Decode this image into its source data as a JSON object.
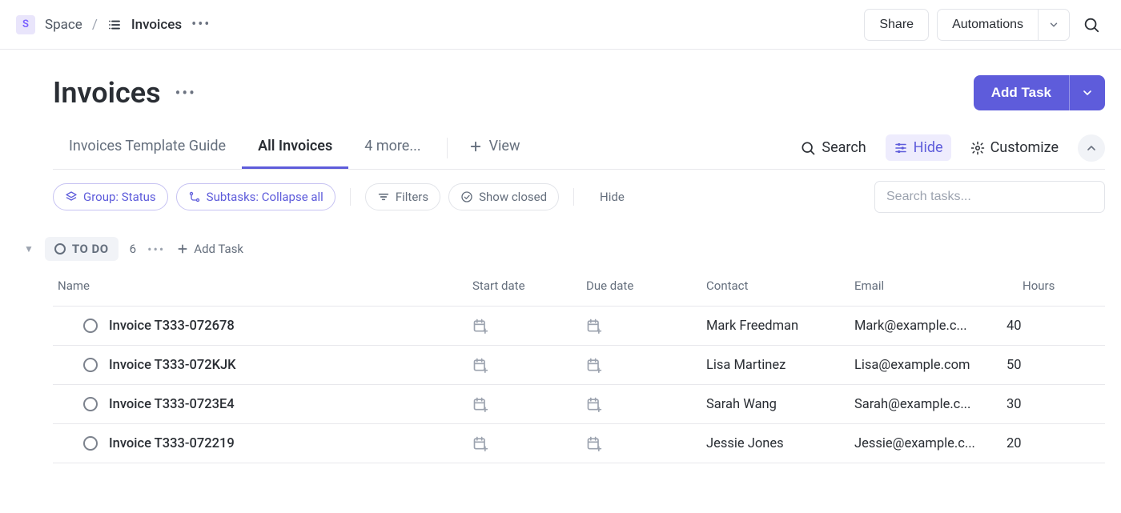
{
  "breadcrumb": {
    "space_letter": "S",
    "space_label": "Space",
    "current": "Invoices"
  },
  "topbar": {
    "share": "Share",
    "automations": "Automations"
  },
  "page": {
    "title": "Invoices",
    "add_task": "Add Task"
  },
  "tabs": {
    "guide": "Invoices Template Guide",
    "all": "All Invoices",
    "more": "4 more...",
    "add_view": "View"
  },
  "tab_actions": {
    "search": "Search",
    "hide": "Hide",
    "customize": "Customize"
  },
  "filters": {
    "group": "Group: Status",
    "subtasks": "Subtasks: Collapse all",
    "filters": "Filters",
    "show_closed": "Show closed",
    "hide": "Hide",
    "search_placeholder": "Search tasks..."
  },
  "group": {
    "status": "TO DO",
    "count": "6",
    "add": "Add Task"
  },
  "columns": {
    "name": "Name",
    "start": "Start date",
    "due": "Due date",
    "contact": "Contact",
    "email": "Email",
    "hours": "Hours"
  },
  "rows": [
    {
      "title": "Invoice T333-072678",
      "contact": "Mark Freedman",
      "email": "Mark@example.c...",
      "hours": "40"
    },
    {
      "title": "Invoice T333-072KJK",
      "contact": "Lisa Martinez",
      "email": "Lisa@example.com",
      "hours": "50"
    },
    {
      "title": "Invoice T333-0723E4",
      "contact": "Sarah Wang",
      "email": "Sarah@example.c...",
      "hours": "30"
    },
    {
      "title": "Invoice T333-072219",
      "contact": "Jessie Jones",
      "email": "Jessie@example.c...",
      "hours": "20"
    }
  ]
}
